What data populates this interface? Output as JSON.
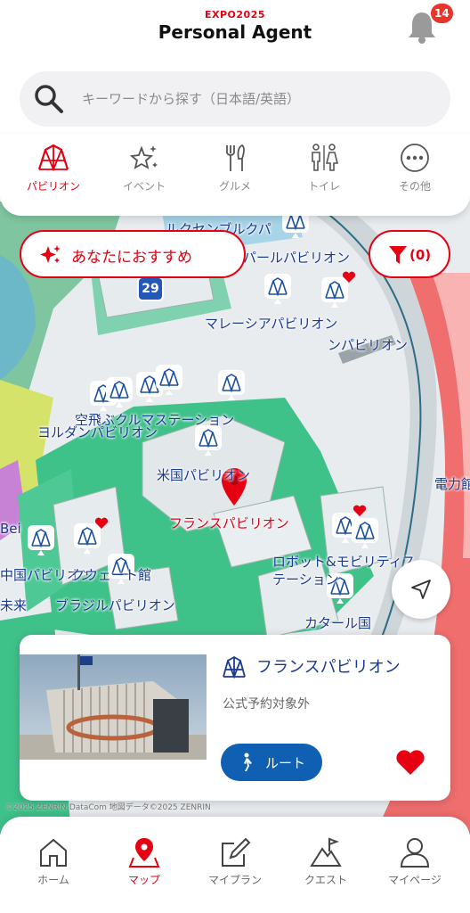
{
  "header": {
    "brand": "EXPO2025",
    "title": "Personal Agent",
    "notification_count": "14"
  },
  "search": {
    "placeholder": "キーワードから探す（日本語/英語）"
  },
  "categories": [
    {
      "label": "パビリオン",
      "icon": "pavilion-icon",
      "active": true
    },
    {
      "label": "イベント",
      "icon": "sparkle-star-icon",
      "active": false
    },
    {
      "label": "グルメ",
      "icon": "fork-knife-icon",
      "active": false
    },
    {
      "label": "トイレ",
      "icon": "restroom-icon",
      "active": false
    },
    {
      "label": "その他",
      "icon": "more-icon",
      "active": false
    }
  ],
  "map": {
    "recommend_label": "あなたにおすすめ",
    "filter_label": "(0)",
    "gate_number": "29",
    "labels": [
      "ルクセンブルクパ",
      "ネパールパビリオン",
      "マレーシアパビリオン",
      "ンパビリオン",
      "空飛ぶクルマステーション",
      "ヨルダンパビリオン",
      "米国パビリオン",
      "フランスパビリオン",
      "電力館",
      "中国パビリオン",
      "クウェート館",
      "ブラジルパビリオン",
      "ロボット&モビリティステーション",
      "カタール国",
      "Bei",
      "未来"
    ]
  },
  "card": {
    "title": "フランスパビリオン",
    "subtitle": "公式予約対象外",
    "route_label": "ルート",
    "favorited": true
  },
  "credit": "©2025 ZENRIN DataCom 地図データ©2025 ZENRIN",
  "nav": [
    {
      "label": "ホーム",
      "icon": "home-icon",
      "active": false
    },
    {
      "label": "マップ",
      "icon": "map-pin-icon",
      "active": true
    },
    {
      "label": "マイプラン",
      "icon": "edit-plan-icon",
      "active": false
    },
    {
      "label": "クエスト",
      "icon": "quest-mountain-icon",
      "active": false
    },
    {
      "label": "マイページ",
      "icon": "person-icon",
      "active": false
    }
  ],
  "colors": {
    "accent": "#e60012",
    "map_label": "#1b3a8f",
    "route_button": "#0f5fb3",
    "map_green": "#3fc18a"
  }
}
